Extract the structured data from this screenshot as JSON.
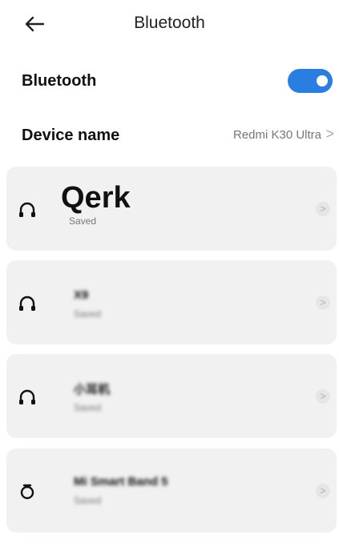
{
  "header": {
    "title": "Bluetooth",
    "back_icon": "arrow-left-icon"
  },
  "settings": {
    "bluetooth_label": "Bluetooth",
    "bluetooth_enabled": true,
    "device_name_label": "Device name",
    "device_name_value": "Redmi K30 Ultra",
    "chevron": ">"
  },
  "devices": [
    {
      "name": "Qerk",
      "status": "Saved",
      "icon": "headset-icon"
    },
    {
      "name": "X9",
      "status": "Saved",
      "icon": "headset-icon"
    },
    {
      "name": "小耳机",
      "status": "Saved",
      "icon": "headset-icon"
    },
    {
      "name": "Mi Smart Band 5",
      "status": "Saved",
      "icon": "band-icon"
    }
  ],
  "device_chevron": ">",
  "colors": {
    "accent": "#2a7de1",
    "card_bg": "#f1f1f1"
  }
}
